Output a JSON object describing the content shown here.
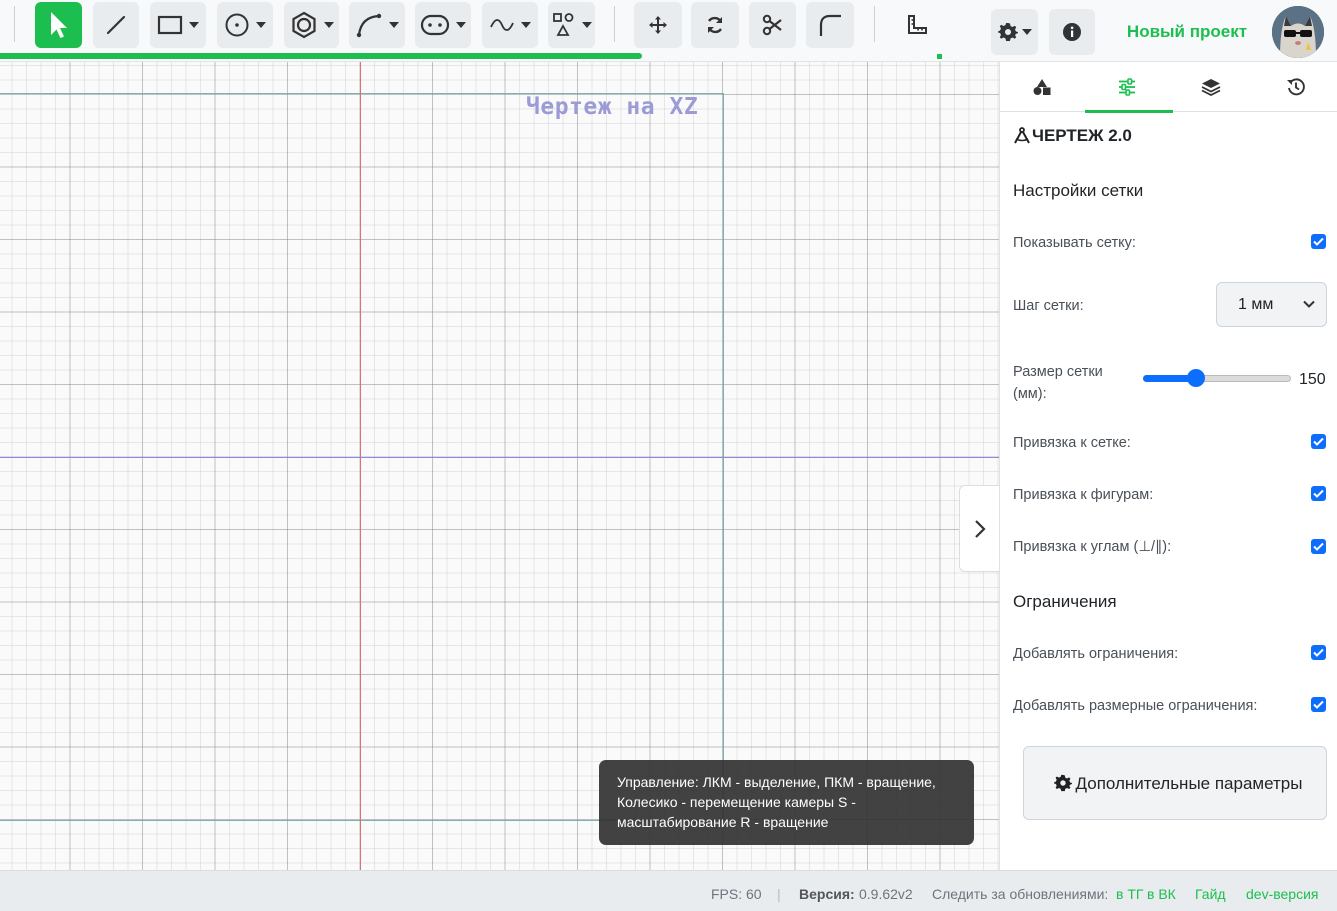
{
  "app": {
    "project_name": "Новый проект",
    "brand": "ЧЕРТЕЖ 2.0",
    "accent_color": "#1cbf4f"
  },
  "toolbar": {
    "progress_percent": 48,
    "tools": [
      {
        "name": "select-tool",
        "icon": "cursor-arrow-icon",
        "active": true
      },
      {
        "name": "line-tool",
        "icon": "line-icon"
      },
      {
        "name": "rectangle-tool",
        "icon": "rectangle-icon",
        "dropdown": true
      },
      {
        "name": "circle-tool",
        "icon": "circle-icon",
        "dropdown": true
      },
      {
        "name": "polygon-tool",
        "icon": "hexagon-icon",
        "dropdown": true
      },
      {
        "name": "arc-tool",
        "icon": "arc-icon",
        "dropdown": true
      },
      {
        "name": "slot-tool",
        "icon": "slot-icon",
        "dropdown": true
      },
      {
        "name": "spline-tool",
        "icon": "spline-icon",
        "dropdown": true
      },
      {
        "name": "shapes-tool",
        "icon": "shapes-icon",
        "dropdown": true
      },
      {
        "name": "move-tool",
        "icon": "move-icon"
      },
      {
        "name": "rotate-tool",
        "icon": "rotate-icon"
      },
      {
        "name": "trim-tool",
        "icon": "scissors-icon"
      },
      {
        "name": "fillet-tool",
        "icon": "fillet-icon"
      },
      {
        "name": "measure-tool",
        "icon": "ruler-icon"
      }
    ]
  },
  "canvas": {
    "title": "Чертеж на XZ"
  },
  "tooltip": {
    "text": "Управление: ЛКМ - выделение, ПКМ - вращение, Колесико - перемещение камеры S - масштабирование R - вращение"
  },
  "panel": {
    "tabs": [
      {
        "icon": "shapes-icon"
      },
      {
        "icon": "sliders-icon",
        "active": true
      },
      {
        "icon": "layers-icon"
      },
      {
        "icon": "history-icon"
      }
    ],
    "grid_section_title": "Настройки сетки",
    "show_grid_label": "Показывать сетку:",
    "show_grid": true,
    "grid_step_label": "Шаг сетки:",
    "grid_step_value": "1 мм",
    "grid_size_label": "Размер сетки (мм):",
    "grid_size_value": "150",
    "grid_size_fraction": 0.36,
    "snap_grid_label": "Привязка к сетке:",
    "snap_grid": true,
    "snap_shapes_label": "Привязка к фигурам:",
    "snap_shapes": true,
    "snap_angles_label": "Привязка к углам (⊥/∥):",
    "snap_angles": true,
    "constraints_section_title": "Ограничения",
    "add_constraints_label": "Добавлять ограничения:",
    "add_constraints": true,
    "add_dim_constraints_label": "Добавлять размерные ограничения:",
    "add_dim_constraints": true,
    "advanced_button_label": "Дополнительные параметры"
  },
  "status": {
    "fps": "FPS: 60",
    "separator": "|",
    "version_label": "Версия:",
    "version_value": "0.9.62v2",
    "follow_label": "Следить за обновлениями:",
    "tg_link": "в ТГ",
    "vk_link": "в ВК",
    "guide_link": "Гайд",
    "dev_link": "dev-версия"
  }
}
